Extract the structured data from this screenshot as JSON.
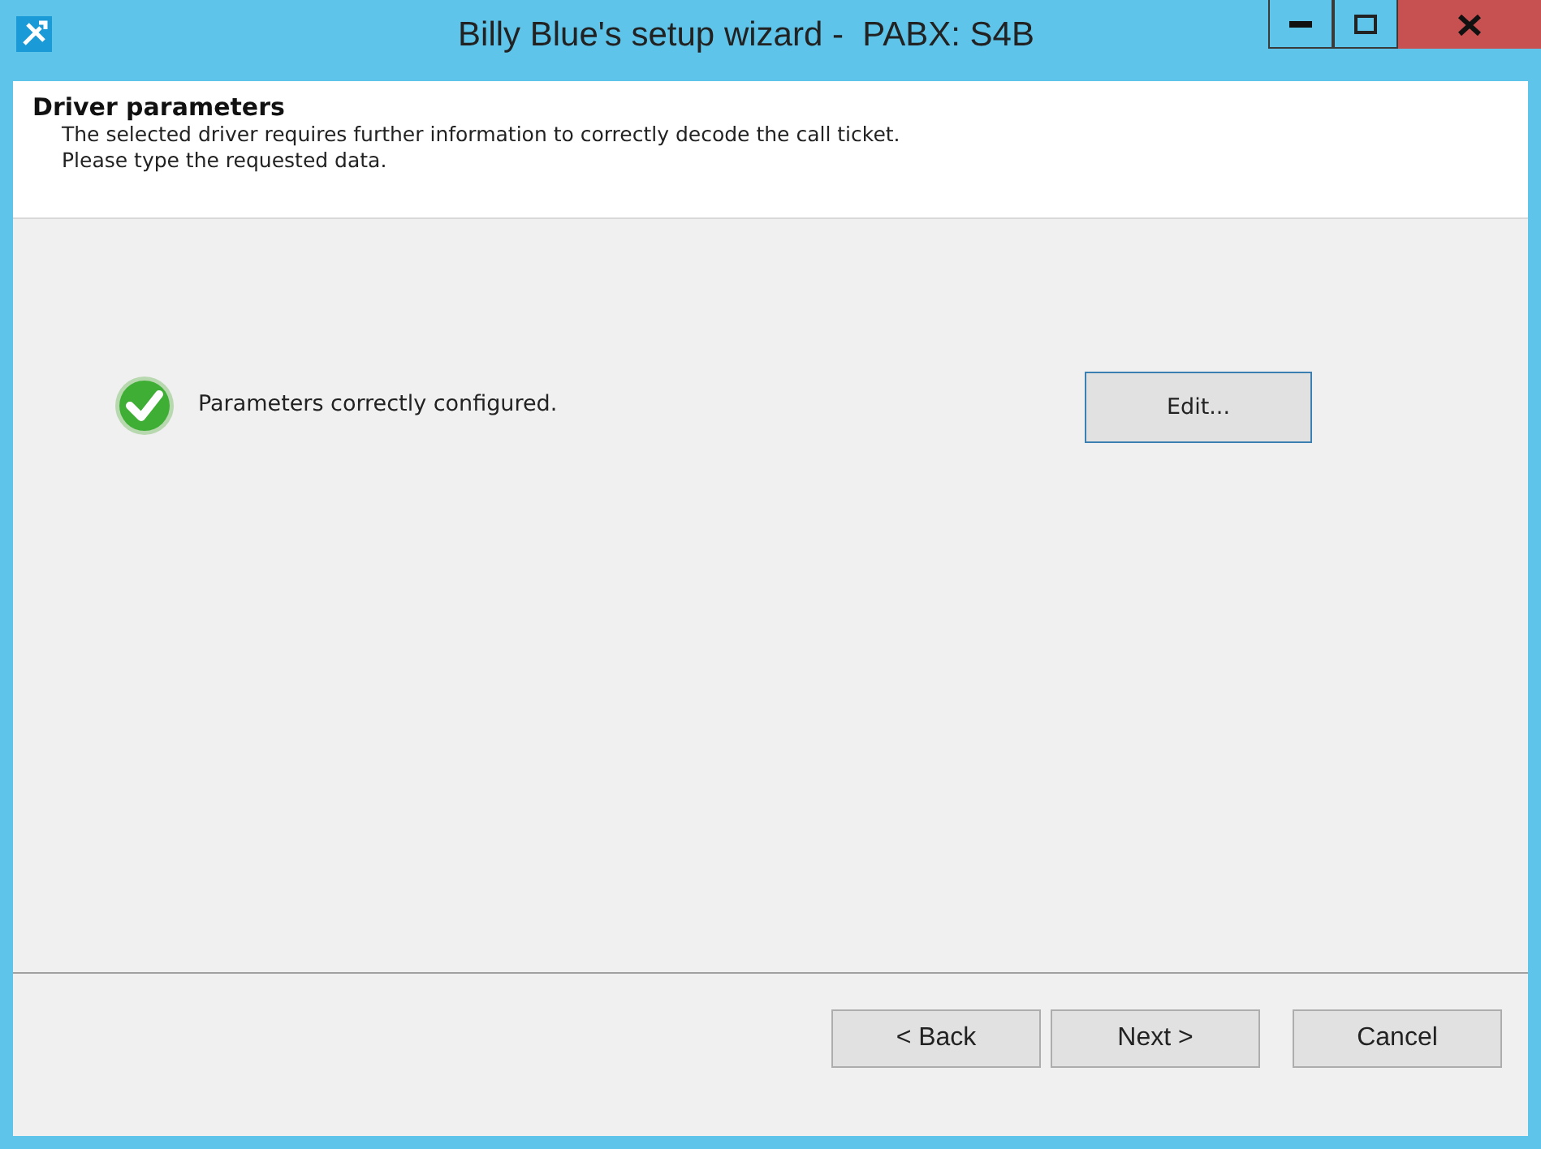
{
  "window": {
    "title": "Billy Blue's setup wizard -  PABX: S4B"
  },
  "header": {
    "title": "Driver parameters",
    "description": "The selected driver requires further information to correctly decode the call ticket.\nPlease type the requested data."
  },
  "status": {
    "message": "Parameters correctly configured.",
    "edit_button": "Edit..."
  },
  "buttons": [
    {
      "label": "< Back"
    },
    {
      "label": "Next >"
    },
    {
      "label": "Cancel"
    }
  ]
}
